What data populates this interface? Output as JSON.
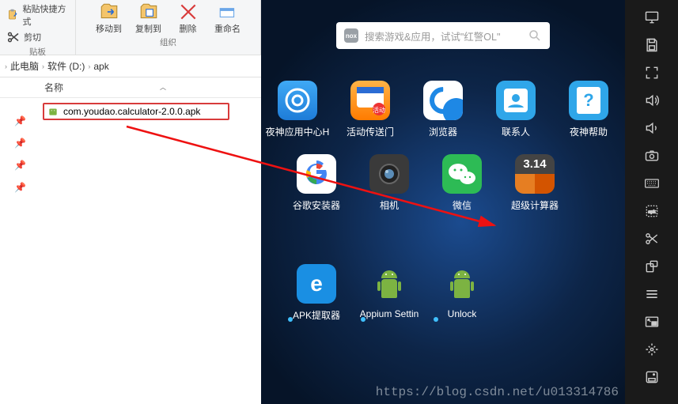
{
  "explorer": {
    "ribbon": {
      "clip": {
        "paste_shortcut": "粘贴快捷方式",
        "cut": "剪切",
        "group": "贴板"
      },
      "org": {
        "move": "移动到",
        "copy": "复制到",
        "delete": "删除",
        "rename": "重命名",
        "group": "组织"
      }
    },
    "breadcrumb": {
      "pc": "此电脑",
      "drive": "软件 (D:)",
      "folder": "apk"
    },
    "columns": {
      "name": "名称"
    },
    "file": {
      "name": "com.youdao.calculator-2.0.0.apk"
    }
  },
  "emulator": {
    "search": {
      "placeholder": "搜索游戏&应用，试试\"红警OL\""
    },
    "apps_row1": [
      {
        "label": "夜神应用中心H",
        "kind": "nox"
      },
      {
        "label": "活动传送门",
        "kind": "portal"
      },
      {
        "label": "浏览器",
        "kind": "browser"
      },
      {
        "label": "联系人",
        "kind": "contacts"
      },
      {
        "label": "夜神帮助",
        "kind": "help"
      }
    ],
    "apps_row2": [
      {
        "label": "谷歌安装器",
        "kind": "google"
      },
      {
        "label": "相机",
        "kind": "camera"
      },
      {
        "label": "微信",
        "kind": "wechat"
      },
      {
        "label": "超级计算器",
        "kind": "calc",
        "badge": "3.14"
      }
    ],
    "apps_row3": [
      {
        "label": "APK提取器",
        "kind": "apke"
      },
      {
        "label": "Appium Settin",
        "kind": "android"
      },
      {
        "label": "Unlock",
        "kind": "android"
      }
    ]
  },
  "sidebar_icons": [
    "monitor",
    "save",
    "fullscreen",
    "volume-up",
    "volume-down",
    "camera",
    "keyboard",
    "apk",
    "scissors",
    "rotate",
    "menu",
    "pip",
    "locate",
    "disk"
  ],
  "watermark": "https://blog.csdn.net/u013314786"
}
